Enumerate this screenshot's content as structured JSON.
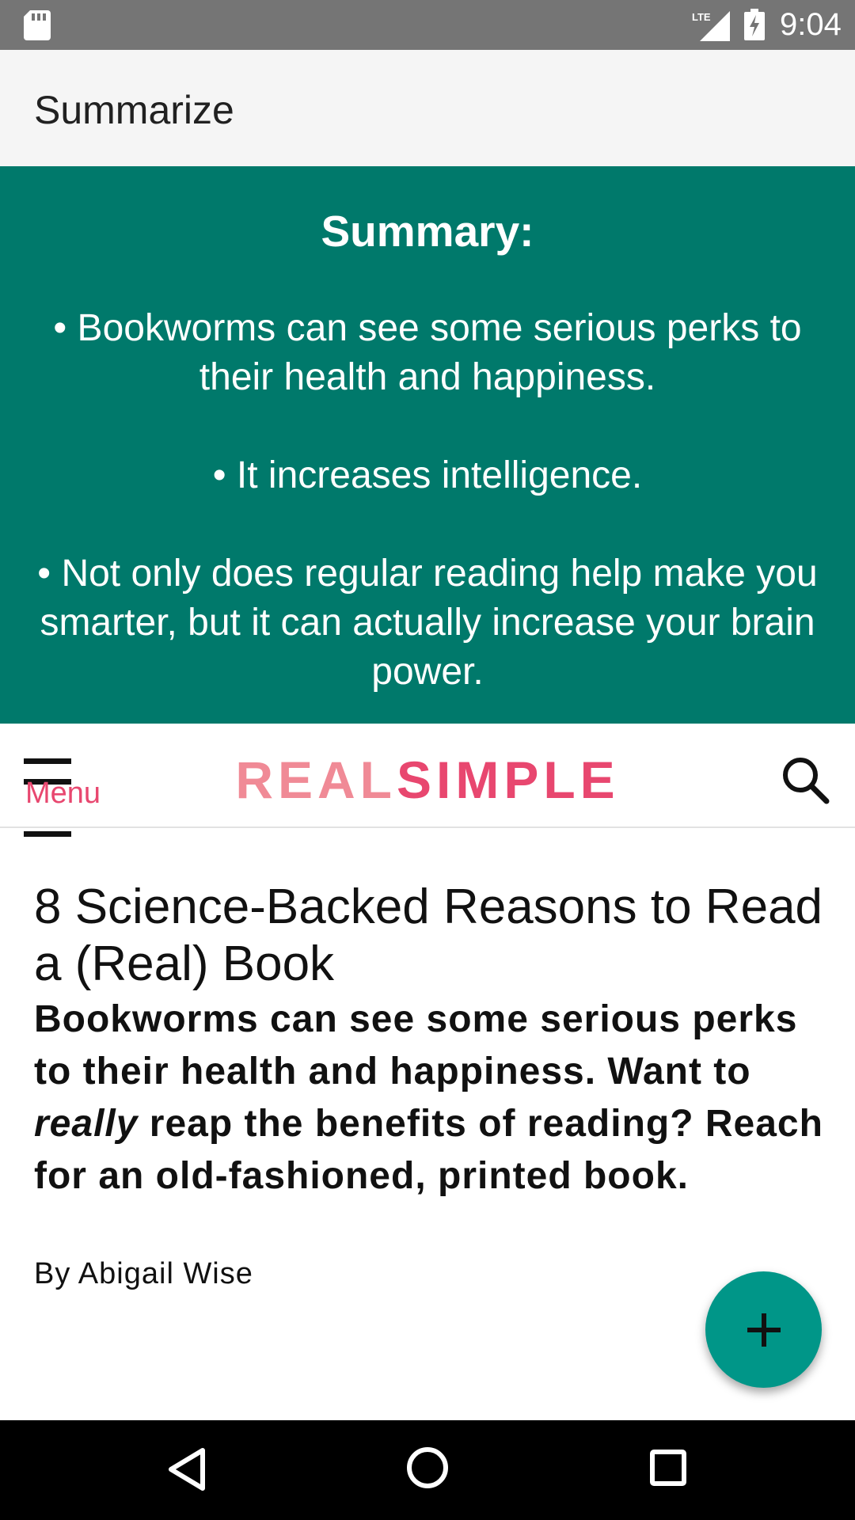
{
  "status_bar": {
    "time": "9:04",
    "network": "LTE",
    "icons": [
      "sd-card-icon",
      "lte-signal-icon",
      "battery-charging-icon"
    ]
  },
  "app_bar": {
    "title": "Summarize"
  },
  "summary": {
    "heading": "Summary:",
    "bullets": [
      "• Bookworms can see some serious perks to their health and happiness.",
      "• It increases intelligence.",
      "• Not only does regular reading help make you smarter, but it can actually increase your brain power."
    ],
    "background_color": "#00796b"
  },
  "web_header": {
    "menu_label": "Menu",
    "logo_part1": "REAL",
    "logo_part2": "SIMPLE",
    "logo_colors": [
      "#f08a96",
      "#e8476f"
    ]
  },
  "article": {
    "title": "8 Science-Backed Reasons to Read a (Real) Book",
    "subtitle_part1": "Bookworms can see some serious perks to their health and happiness. Want to ",
    "subtitle_emphasis": "really",
    "subtitle_part2": " reap the benefits of reading? Reach for an old-fashioned, printed book.",
    "byline": "By Abigail Wise"
  },
  "fab": {
    "icon": "plus-icon",
    "color": "#009688"
  },
  "nav_bar": {
    "icons": [
      "back-icon",
      "home-icon",
      "recents-icon"
    ]
  }
}
